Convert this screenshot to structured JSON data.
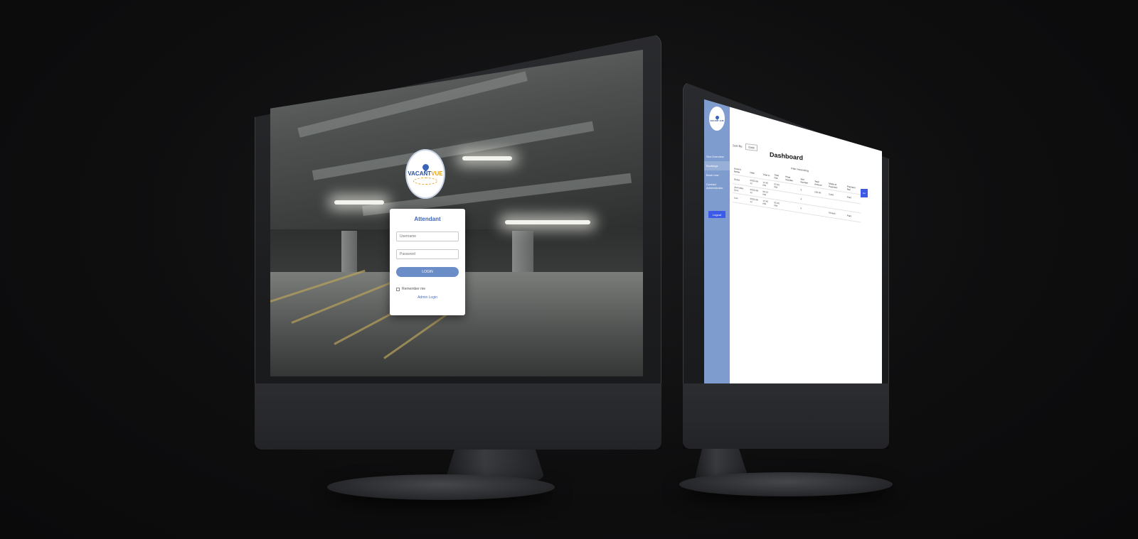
{
  "login": {
    "logo_text_main": "VACANT",
    "logo_text_accent": "VUE",
    "title": "Attendant",
    "username_placeholder": "Username",
    "password_placeholder": "Password",
    "login_button": "LOGIN",
    "remember_label": "Remember me",
    "admin_link": "Admin Login"
  },
  "dashboard": {
    "logo_text": "VACANT VUE",
    "title": "Dashboard",
    "sort_label": "Sort By:",
    "sort_value": "Date",
    "filter_label": "Filter",
    "filter_value": "Ascending",
    "search_button": "Go",
    "sidebar_items": [
      "Slot Overview",
      "Bookings",
      "Book now",
      "Contact Administrator"
    ],
    "logout_button": "Logout",
    "table_headers": [
      "Driver's Name",
      "Date",
      "Time in",
      "Time Out",
      "Plate Number",
      "Slot Number",
      "Total Amount",
      "Mode of Payment",
      "Payment Ref."
    ],
    "table_rows": [
      [
        "Grace",
        "2023-06-12",
        "12:45 PM",
        "02:45 PM",
        "",
        "3",
        "150.00",
        "Cash",
        "Paid"
      ],
      [
        "Juan dela Cruz",
        "2023-06-12",
        "09:12 PM",
        "",
        "",
        "4",
        "",
        "",
        ""
      ],
      [
        "Luis",
        "2023-06-12",
        "12:45 PM",
        "05:45 PM",
        "",
        "5",
        "",
        "GCash",
        "Paid"
      ]
    ]
  },
  "colors": {
    "accent_blue": "#3f64b5",
    "button_blue": "#6a8cc7",
    "sidebar_blue": "#7f9ccf",
    "logout_blue": "#3c5ae8",
    "logo_gold": "#e1a623"
  }
}
